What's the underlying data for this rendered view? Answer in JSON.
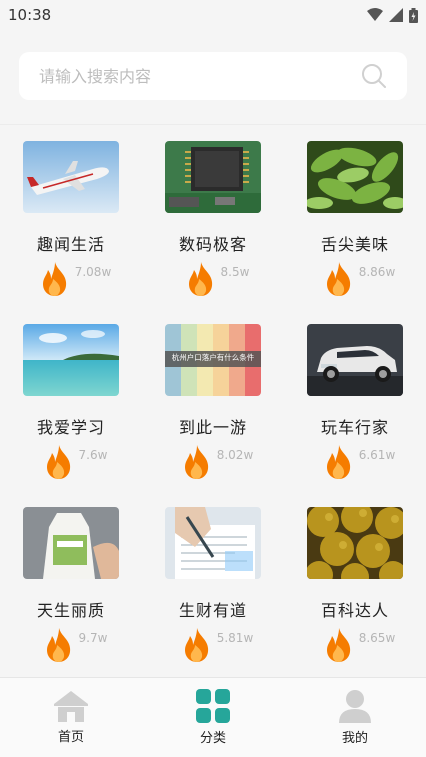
{
  "status": {
    "time": "10:38"
  },
  "search": {
    "placeholder": "请输入搜索内容"
  },
  "categories": [
    {
      "title": "趣闻生活",
      "count": "7.08w",
      "thumb": "airplane"
    },
    {
      "title": "数码极客",
      "count": "8.5w",
      "thumb": "chip"
    },
    {
      "title": "舌尖美味",
      "count": "8.86w",
      "thumb": "edamame"
    },
    {
      "title": "我爱学习",
      "count": "7.6w",
      "thumb": "seascape"
    },
    {
      "title": "到此一游",
      "count": "8.02w",
      "thumb": "banner",
      "thumb_text": "杭州户口落户有什么条件"
    },
    {
      "title": "玩车行家",
      "count": "6.61w",
      "thumb": "car"
    },
    {
      "title": "天生丽质",
      "count": "9.7w",
      "thumb": "bottle"
    },
    {
      "title": "生财有道",
      "count": "5.81w",
      "thumb": "paperwork"
    },
    {
      "title": "百科达人",
      "count": "8.65w",
      "thumb": "durian"
    }
  ],
  "tabs": [
    {
      "label": "首页",
      "icon": "home-icon",
      "active": false
    },
    {
      "label": "分类",
      "icon": "grid-icon",
      "active": true
    },
    {
      "label": "我的",
      "icon": "person-icon",
      "active": false
    }
  ],
  "colors": {
    "accent": "#26a69a",
    "flame_outer": "#f57c00",
    "flame_inner": "#ffb74d",
    "inactive_icon": "#cfcfcf"
  }
}
